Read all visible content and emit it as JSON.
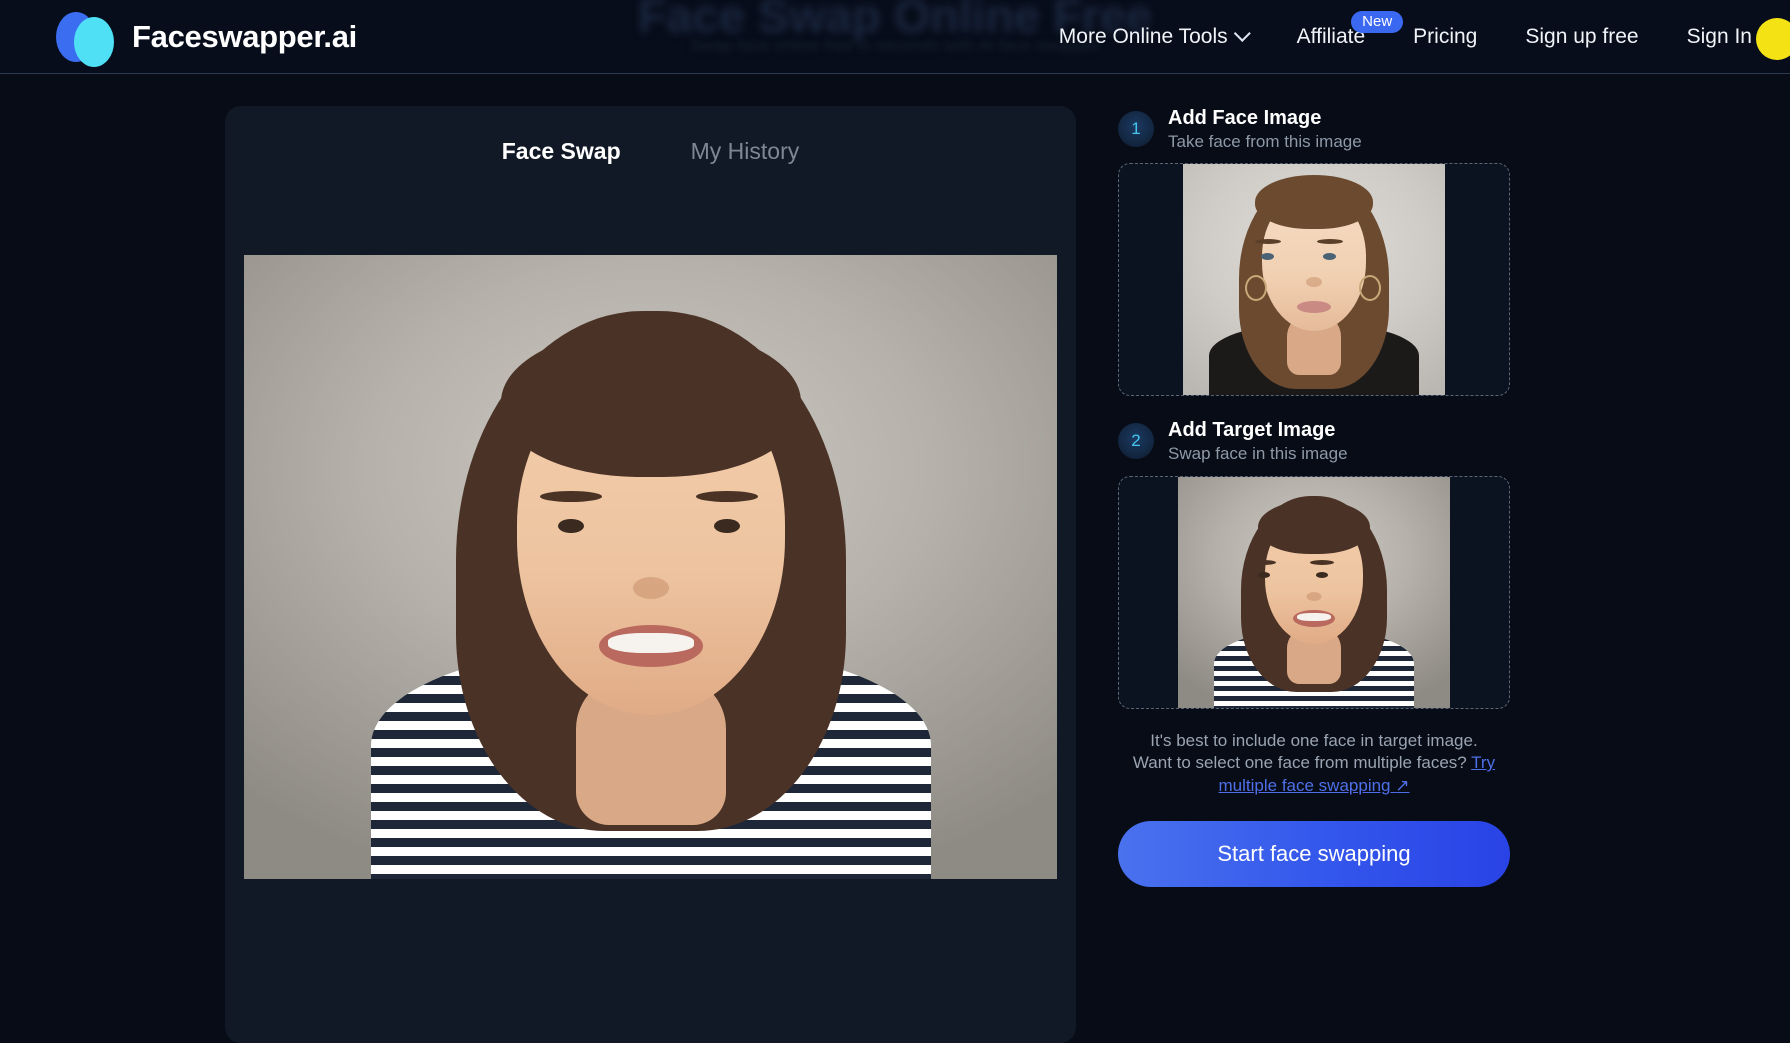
{
  "header": {
    "logo_text": "Faceswapper.ai",
    "ghost_title": "Face Swap Online Free",
    "ghost_subtitle": "Swap face online free in seconds with AI face swapper",
    "nav": {
      "more_tools": "More Online Tools",
      "affiliate": "Affiliate",
      "affiliate_badge": "New",
      "pricing": "Pricing",
      "signup": "Sign up free",
      "signin": "Sign In"
    }
  },
  "main": {
    "tabs": [
      {
        "label": "Face Swap",
        "active": true
      },
      {
        "label": "My History",
        "active": false
      }
    ]
  },
  "panel": {
    "steps": [
      {
        "number": "1",
        "title": "Add Face Image",
        "subtitle": "Take face from this image"
      },
      {
        "number": "2",
        "title": "Add Target Image",
        "subtitle": "Swap face in this image"
      }
    ],
    "help": {
      "line1": "It's best to include one face in target image.",
      "line2": "Want to select one face from multiple faces?",
      "link": "Try multiple face swapping",
      "link_arrow": "↗"
    },
    "cta_label": "Start face swapping"
  },
  "colors": {
    "accent_blue": "#3b68f0",
    "accent_cyan": "#4fe0f5",
    "page_bg": "#070c17",
    "card_bg": "#121926",
    "link": "#4f6fe8",
    "avatar": "#f4e215"
  }
}
